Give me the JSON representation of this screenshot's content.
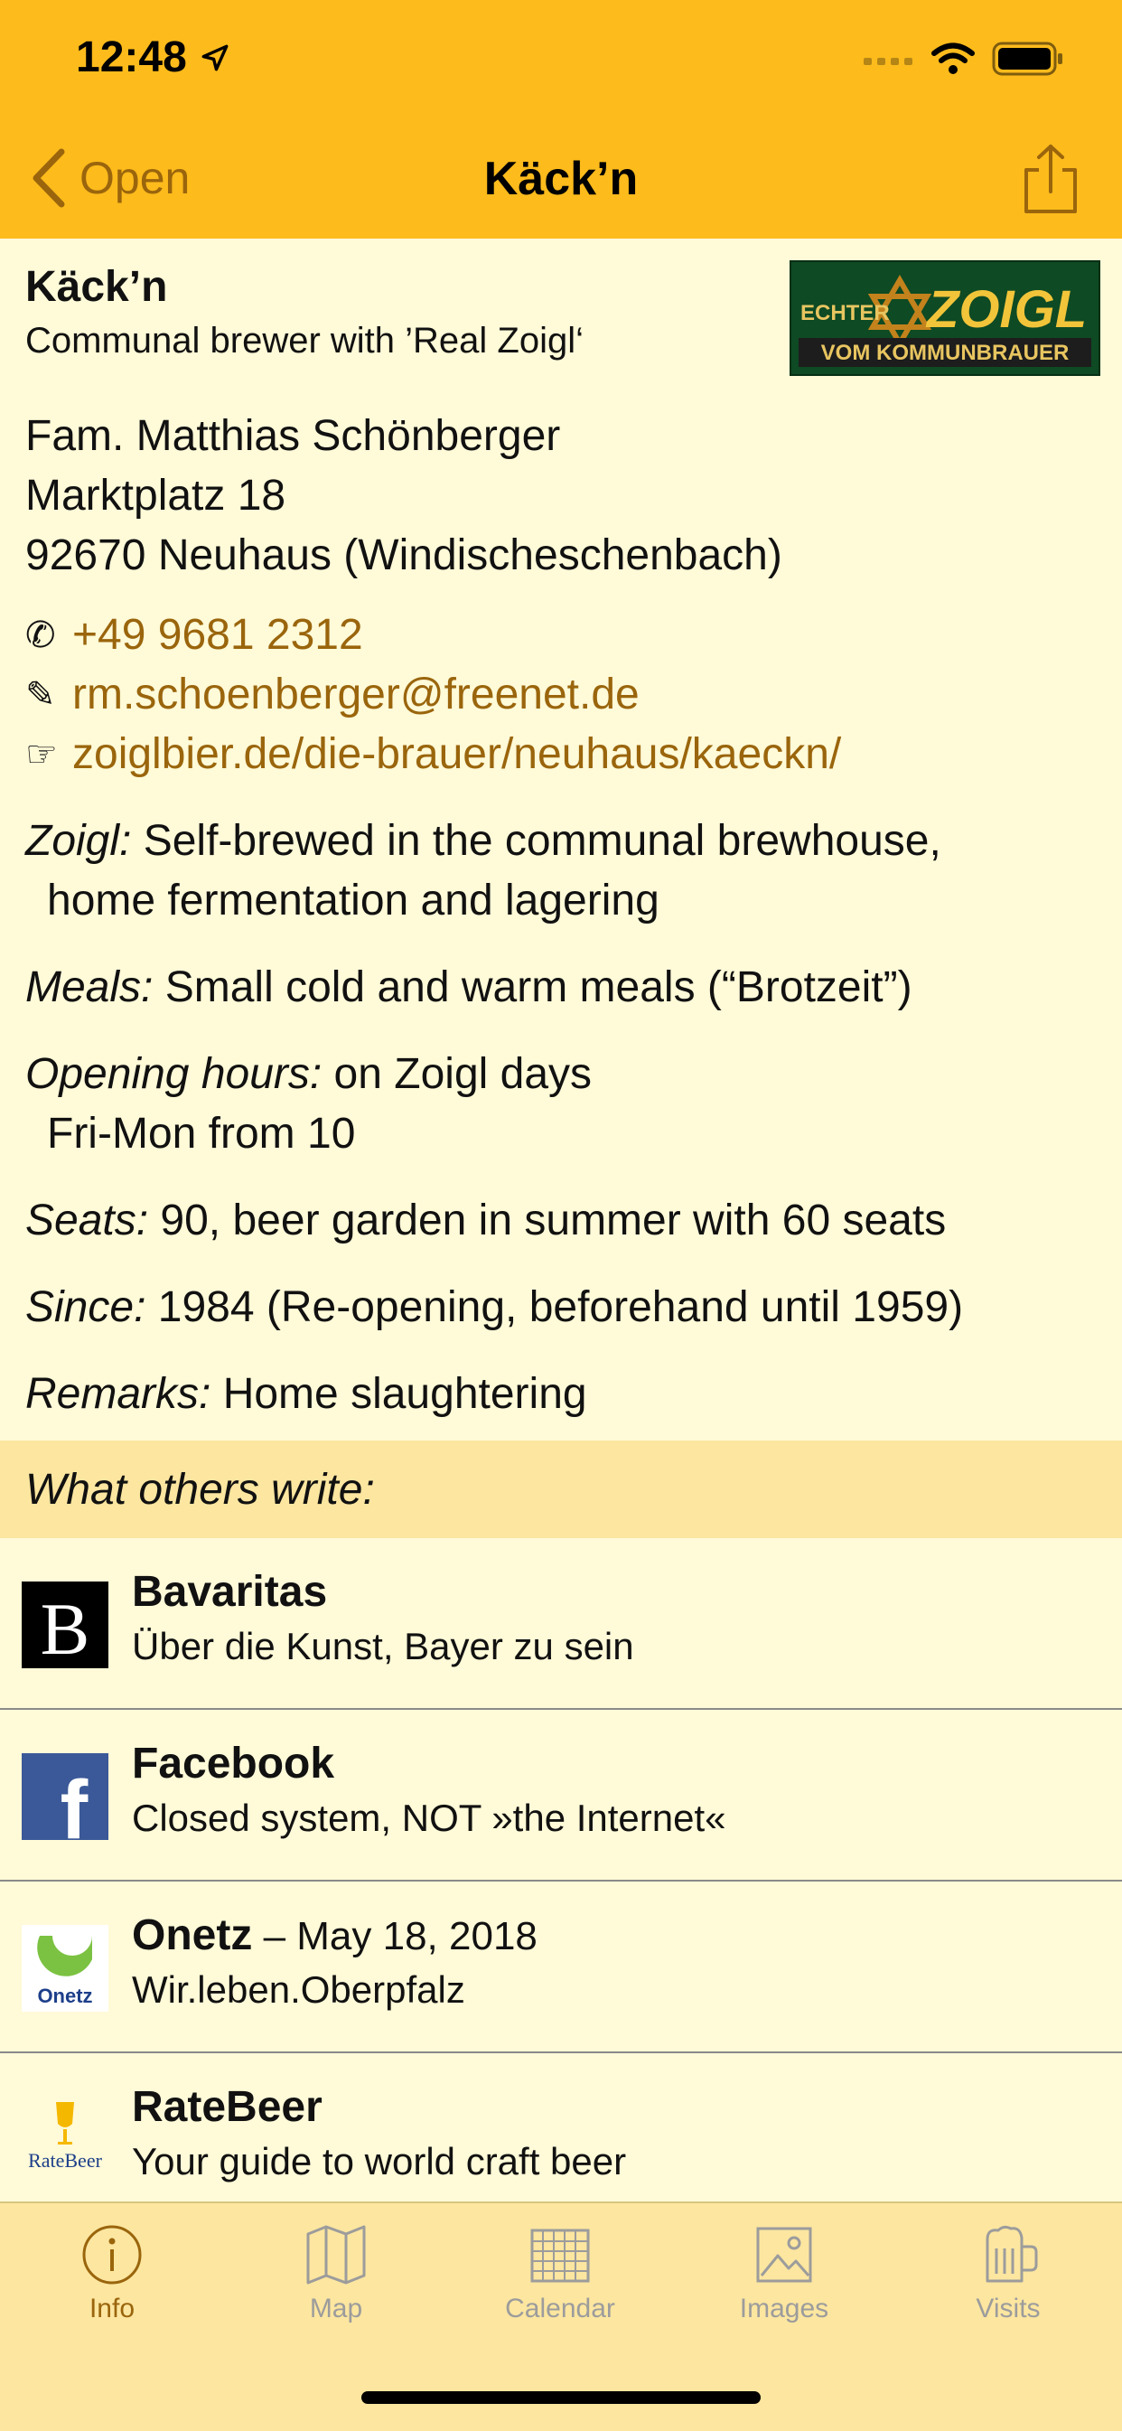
{
  "status": {
    "time": "12:48"
  },
  "nav": {
    "back_label": "Open",
    "title": "Käck’n"
  },
  "place": {
    "name": "Käck’n",
    "subtitle": "Communal brewer with ’Real Zoigl‘",
    "logo_text": {
      "left": "ECHTER",
      "main": "ZOIGL",
      "bottom": "VOM KOMMUNBRAUER"
    },
    "address": [
      "Fam. Matthias Schönberger",
      "Marktplatz 18",
      "92670 Neuhaus (Windischeschenbach)"
    ],
    "phone": "+49 9681 2312",
    "email": "rm.schoenberger@freenet.de",
    "website": "zoiglbier.de/die-brauer/neuhaus/kaeckn/",
    "symbols": {
      "phone": "✆",
      "email": "✎",
      "web": "☞"
    }
  },
  "fields": {
    "zoigl": {
      "label": "Zoigl:",
      "line1": " Self-brewed in the communal brewhouse,",
      "line2": "home fermentation and lagering"
    },
    "meals": {
      "label": "Meals:",
      "value": " Small cold and warm meals (“Brotzeit”)"
    },
    "hours": {
      "label": "Opening hours:",
      "line1": " on Zoigl days",
      "line2": "Fri-Mon from 10"
    },
    "seats": {
      "label": "Seats:",
      "value": " 90, beer garden in summer with 60 seats"
    },
    "since": {
      "label": "Since:",
      "value": " 1984 (Re-opening, beforehand until 1959)"
    },
    "remarks": {
      "label": "Remarks:",
      "value": " Home slaughtering"
    }
  },
  "others": {
    "header": "What others write:",
    "items": [
      {
        "title": "Bavaritas",
        "date": "",
        "subtitle": "Über die Kunst, Bayer zu sein",
        "icon": "bavaritas-logo",
        "icon_text": "B"
      },
      {
        "title": "Facebook",
        "date": "",
        "subtitle": "Closed system, NOT »the Internet«",
        "icon": "facebook-logo",
        "icon_text": "f"
      },
      {
        "title": "Onetz",
        "date": " – May 18, 2018",
        "subtitle": "Wir.leben.Oberpfalz",
        "icon": "onetz-logo",
        "icon_text": "Onetz"
      },
      {
        "title": "RateBeer",
        "date": "",
        "subtitle": "Your guide to world craft beer",
        "icon": "ratebeer-logo",
        "icon_text": "RateBeer"
      }
    ]
  },
  "tabs": [
    {
      "label": "Info",
      "icon": "info-icon",
      "active": true
    },
    {
      "label": "Map",
      "icon": "map-icon",
      "active": false
    },
    {
      "label": "Calendar",
      "icon": "calendar-icon",
      "active": false
    },
    {
      "label": "Images",
      "icon": "images-icon",
      "active": false
    },
    {
      "label": "Visits",
      "icon": "beer-mug-icon",
      "active": false
    }
  ],
  "colors": {
    "accent": "#FDBB1C",
    "link": "#9A650C",
    "background": "#FFFAD8",
    "section": "#FCE6A0"
  }
}
